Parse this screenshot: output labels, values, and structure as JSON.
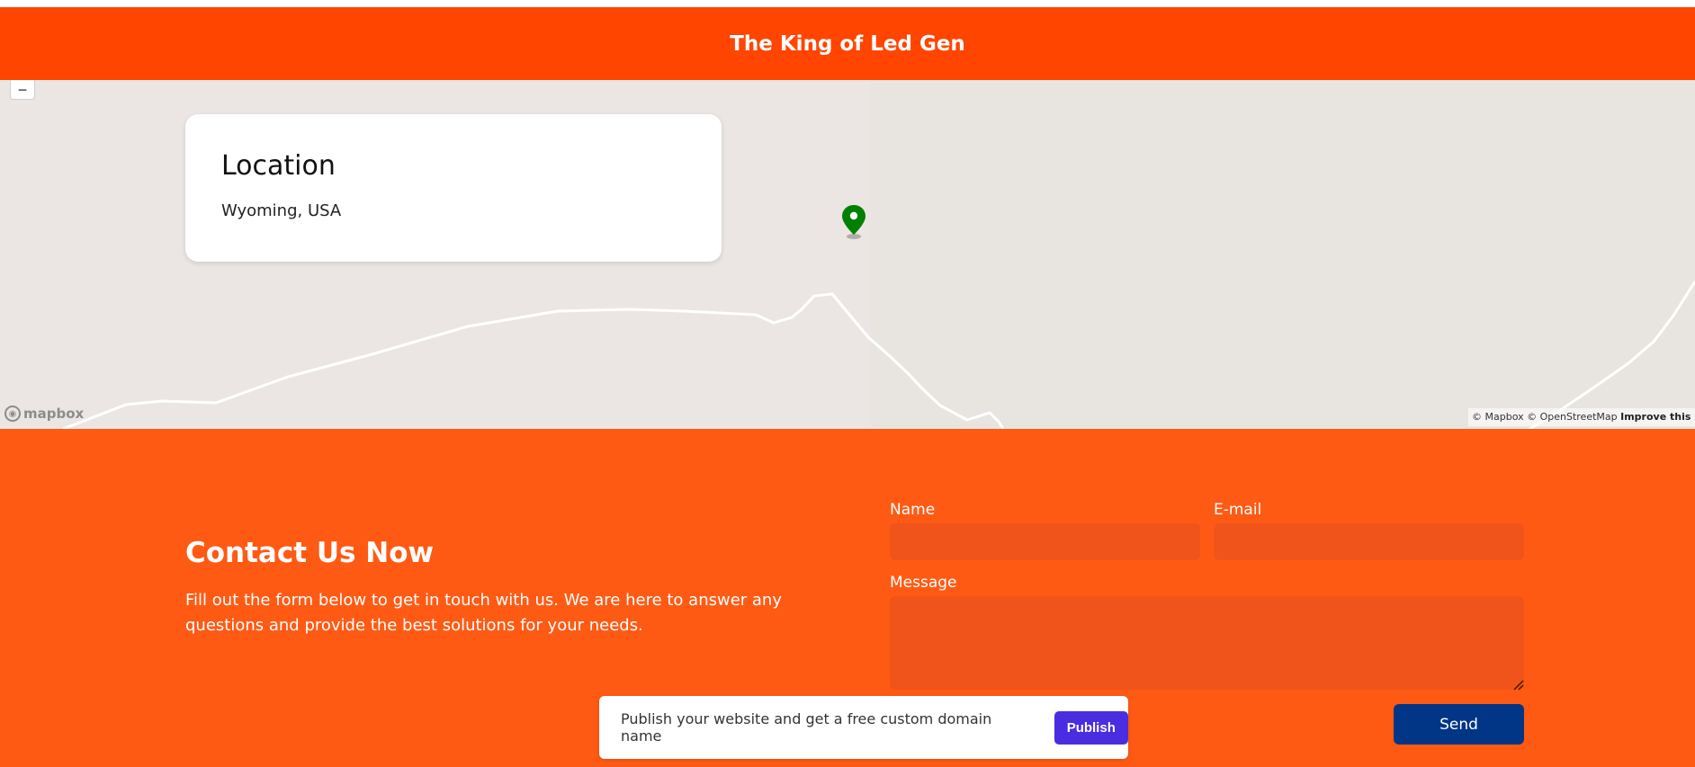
{
  "header": {
    "title": "The King of Led Gen"
  },
  "map": {
    "zoom_out_label": "−",
    "location_card": {
      "title": "Location",
      "address": "Wyoming, USA"
    },
    "marker_color": "#008000",
    "logo_text": "mapbox",
    "attribution": {
      "mapbox": "© Mapbox",
      "osm": "© OpenStreetMap",
      "improve": "Improve this map"
    }
  },
  "contact": {
    "title": "Contact Us Now",
    "description": "Fill out the form below to get in touch with us. We are here to answer any questions and provide the best solutions for your needs.",
    "form": {
      "name_label": "Name",
      "name_value": "",
      "email_label": "E-mail",
      "email_value": "",
      "message_label": "Message",
      "message_value": "",
      "send_label": "Send"
    }
  },
  "publish_bar": {
    "text": "Publish your website and get a free custom domain name",
    "button_label": "Publish"
  },
  "colors": {
    "header_bg": "#ff4500",
    "contact_bg": "#ff5a14",
    "send_button": "#003685",
    "publish_button": "#4a2de0"
  }
}
